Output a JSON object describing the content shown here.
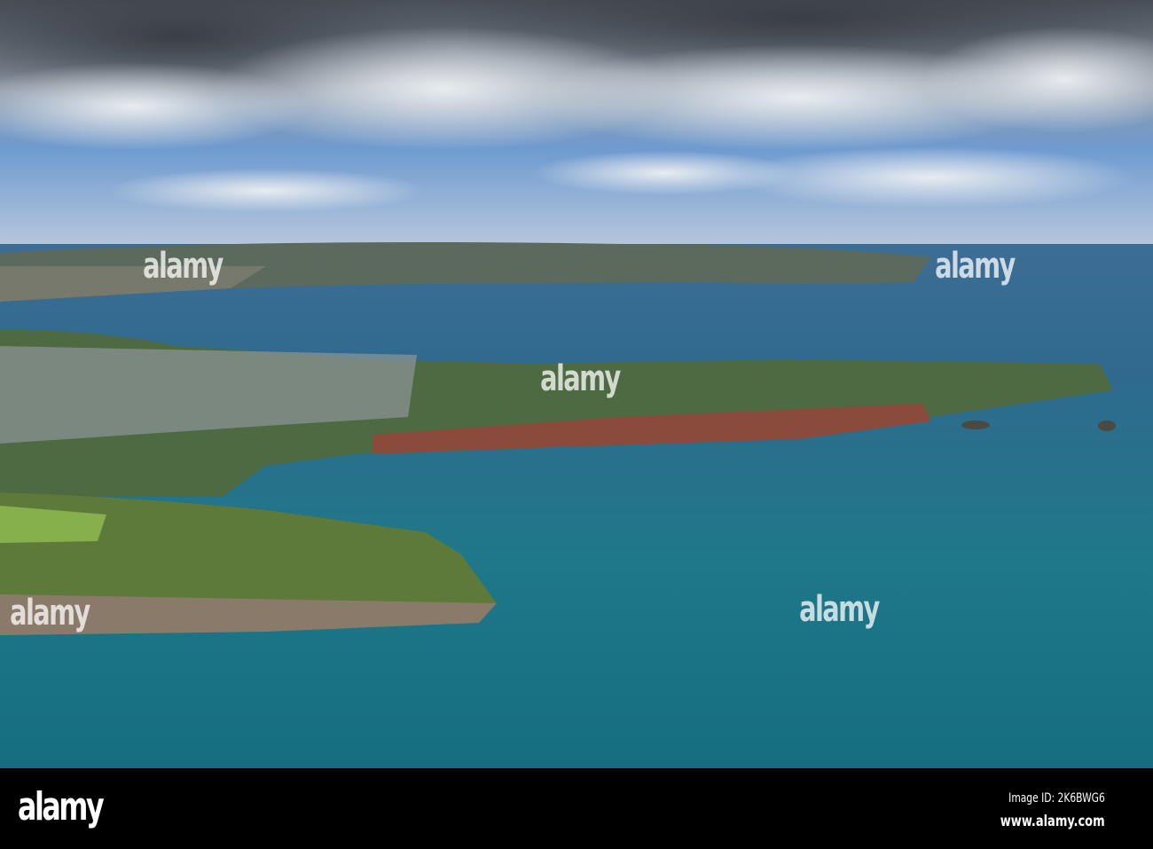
{
  "photo": {
    "description_alt": "Aerial view of coastal headlands and bay",
    "watermark": "alamy"
  },
  "footer": {
    "logo": "alamy",
    "image_id": "Image ID: 2K6BWG6",
    "url": "www.alamy.com"
  }
}
